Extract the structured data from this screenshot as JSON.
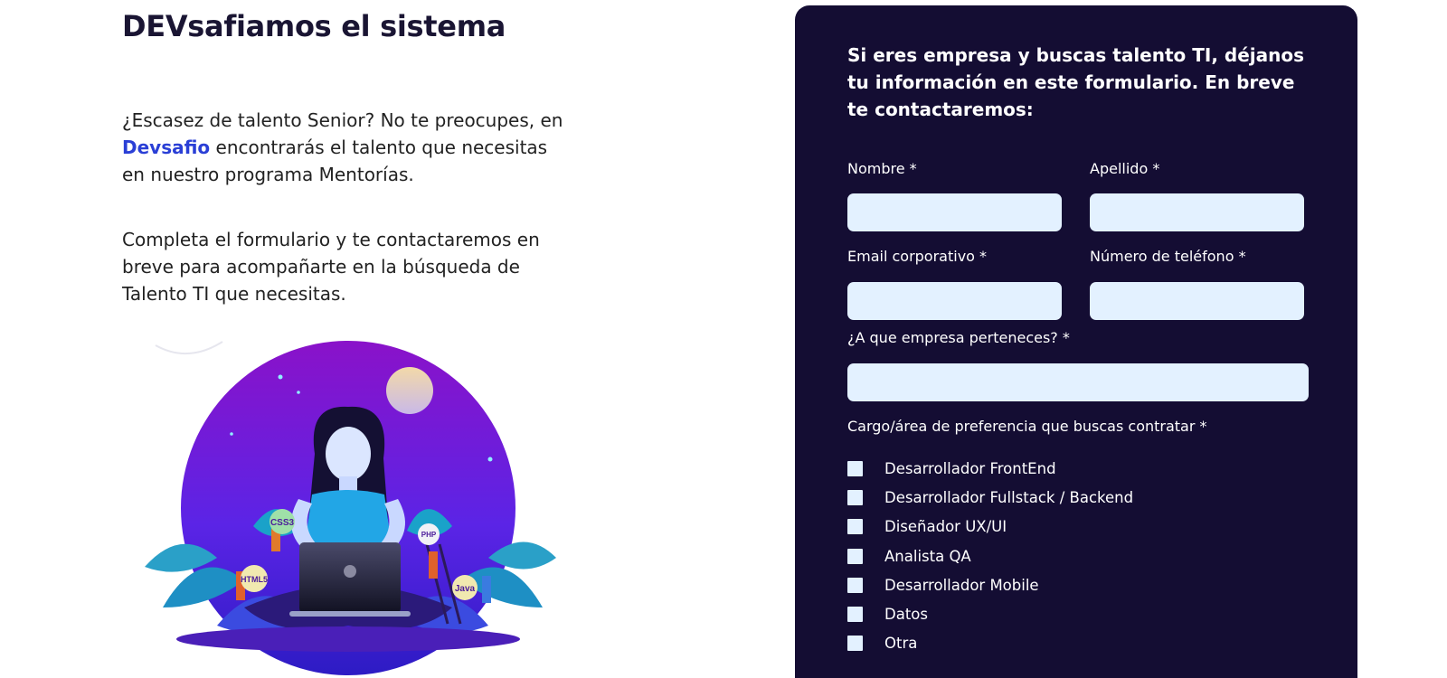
{
  "left": {
    "title": "DEVsafiamos el sistema",
    "intro_before": "¿Escasez de talento Senior? No te preocupes, en ",
    "intro_brand": "Devsafio",
    "intro_after": " encontrarás el talento que necesitas en nuestro programa Mentorías.",
    "paragraph2": "Completa el formulario y te contactaremos en breve para acompañarte en la búsqueda de Talento TI que necesitas.",
    "illustration_badges": [
      "CSS3",
      "PHP",
      "HTML5",
      "Java"
    ]
  },
  "form": {
    "heading": "Si eres empresa y buscas talento TI, déjanos tu información en este formulario. En breve te contactaremos:",
    "fields": {
      "nombre": {
        "label": "Nombre *",
        "value": ""
      },
      "apellido": {
        "label": "Apellido *",
        "value": ""
      },
      "email": {
        "label": "Email corporativo *",
        "value": ""
      },
      "telefono": {
        "label": "Número de teléfono *",
        "value": ""
      },
      "empresa": {
        "label": "¿A que empresa perteneces? *",
        "value": ""
      }
    },
    "question": "Cargo/área de preferencia que buscas contratar *",
    "options": [
      "Desarrollador FrontEnd",
      "Desarrollador Fullstack / Backend",
      "Diseñador UX/UI",
      "Analista QA",
      "Desarrollador Mobile",
      "Datos",
      "Otra"
    ]
  },
  "colors": {
    "card_bg": "#140d33",
    "input_bg": "#e3f1ff",
    "brand_link": "#2a3fd6",
    "illustration_purple": "#7a1ee0"
  }
}
